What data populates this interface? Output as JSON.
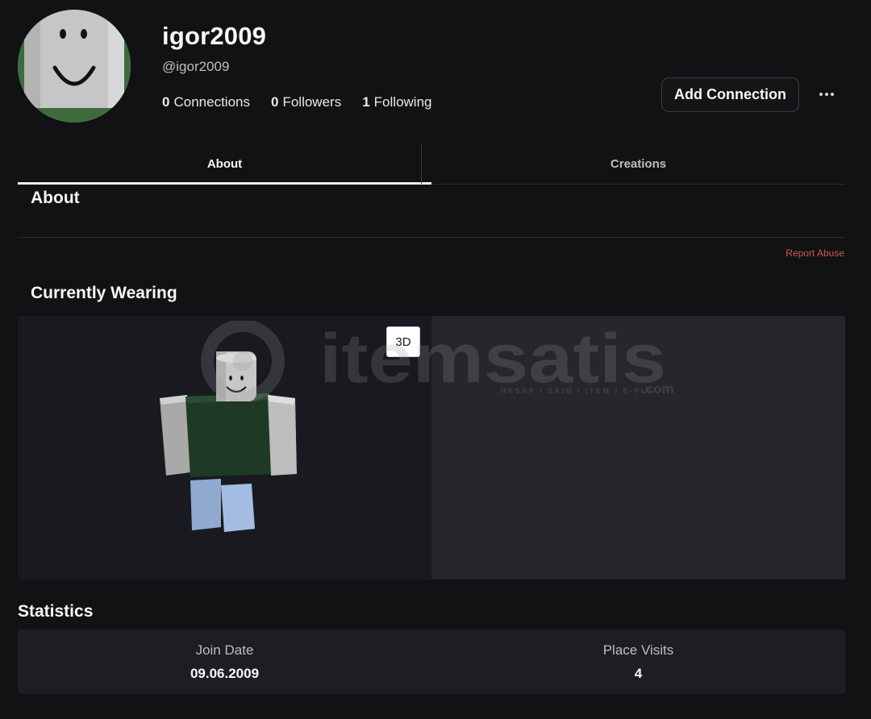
{
  "profile": {
    "display_name": "igor2009",
    "username": "@igor2009",
    "counts": [
      {
        "number": "0",
        "label": "Connections"
      },
      {
        "number": "0",
        "label": "Followers"
      },
      {
        "number": "1",
        "label": "Following"
      }
    ],
    "add_connection_label": "Add Connection"
  },
  "tabs": [
    {
      "label": "About",
      "active": true
    },
    {
      "label": "Creations",
      "active": false
    }
  ],
  "about": {
    "title": "About",
    "report_label": "Report Abuse"
  },
  "wearing": {
    "title": "Currently Wearing",
    "toggle_label": "3D"
  },
  "watermark": {
    "brand": "itemsatis",
    "tagline": "HESAP / SKIN / ITEM / E-PIN",
    "suffix": ".com"
  },
  "statistics": {
    "title": "Statistics",
    "items": [
      {
        "label": "Join Date",
        "value": "09.06.2009"
      },
      {
        "label": "Place Visits",
        "value": "4"
      }
    ]
  },
  "colors": {
    "background": "#111214",
    "report_link": "#d2564b",
    "shirt": "#1f3a24",
    "pants": "#9bb6da",
    "skin": "#c9c9c9"
  },
  "icons": [
    "more-horizontal-icon",
    "avatar-headshot",
    "avatar-3d-figure"
  ]
}
